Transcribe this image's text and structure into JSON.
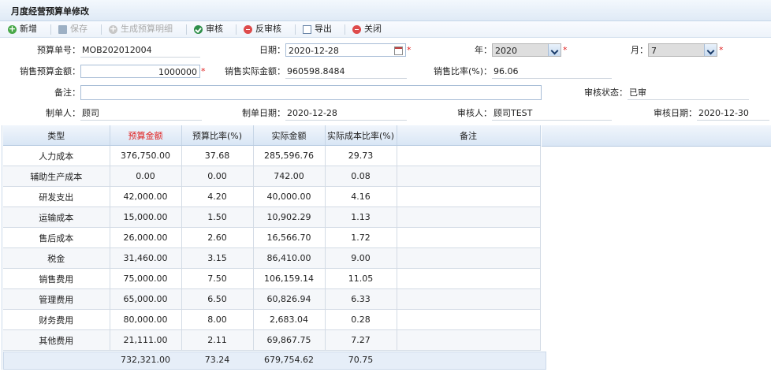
{
  "title": "月度经营预算单修改",
  "toolbar": {
    "add": "新增",
    "save": "保存",
    "generate": "生成预算明细",
    "audit": "审核",
    "unaudit": "反审核",
    "export": "导出",
    "close": "关闭"
  },
  "form": {
    "budget_no_label": "预算单号：",
    "budget_no": "MOB202012004",
    "date_label": "日期：",
    "date": "2020-12-28",
    "year_label": "年：",
    "year": "2020",
    "month_label": "月：",
    "month": "7",
    "sales_budget_label": "销售预算金额：",
    "sales_budget": "1000000",
    "sales_actual_label": "销售实际金额：",
    "sales_actual": "960598.8484",
    "sales_ratio_label": "销售比率(%)：",
    "sales_ratio": "96.06",
    "remark_label": "备注：",
    "remark": "",
    "audit_status_label": "审核状态：",
    "audit_status": "已审",
    "creator_label": "制单人：",
    "creator": "顾司",
    "create_date_label": "制单日期：",
    "create_date": "2020-12-28",
    "auditor_label": "审核人：",
    "auditor": "顾司TEST",
    "audit_date_label": "审核日期：",
    "audit_date": "2020-12-30",
    "required_mark": "*"
  },
  "table": {
    "headers": [
      "类型",
      "预算金额",
      "预算比率(%)",
      "实际金额",
      "实际成本比率(%)",
      "备注"
    ],
    "rows": [
      [
        "人力成本",
        "376,750.00",
        "37.68",
        "285,596.76",
        "29.73",
        ""
      ],
      [
        "辅助生产成本",
        "0.00",
        "0.00",
        "742.00",
        "0.08",
        ""
      ],
      [
        "研发支出",
        "42,000.00",
        "4.20",
        "40,000.00",
        "4.16",
        ""
      ],
      [
        "运输成本",
        "15,000.00",
        "1.50",
        "10,902.29",
        "1.13",
        ""
      ],
      [
        "售后成本",
        "26,000.00",
        "2.60",
        "16,566.70",
        "1.72",
        ""
      ],
      [
        "税金",
        "31,460.00",
        "3.15",
        "86,410.00",
        "9.00",
        ""
      ],
      [
        "销售费用",
        "75,000.00",
        "7.50",
        "106,159.14",
        "11.05",
        ""
      ],
      [
        "管理费用",
        "65,000.00",
        "6.50",
        "60,826.94",
        "6.33",
        ""
      ],
      [
        "财务费用",
        "80,000.00",
        "8.00",
        "2,683.04",
        "0.28",
        ""
      ],
      [
        "其他费用",
        "21,111.00",
        "2.11",
        "69,867.75",
        "7.27",
        ""
      ]
    ],
    "totals": [
      "732,321.00",
      "73.24",
      "679,754.62",
      "70.75"
    ]
  },
  "colors": {
    "required": "#e02020",
    "header_bg": "#dfeaf6",
    "budget_header": "#e02020"
  }
}
